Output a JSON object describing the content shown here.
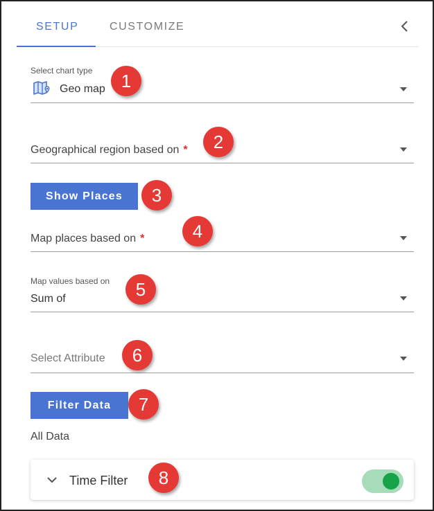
{
  "tabs": {
    "setup": "SETUP",
    "customize": "CUSTOMIZE",
    "active": "setup"
  },
  "chart_type": {
    "caption": "Select chart type",
    "value": "Geo map",
    "icon": "geo-map-icon"
  },
  "region": {
    "label": "Geographical region based on",
    "required_mark": "*"
  },
  "show_places_button": "Show Places",
  "map_places": {
    "label": "Map places based on",
    "required_mark": "*"
  },
  "map_values": {
    "caption": "Map values based on",
    "value": "Sum of"
  },
  "attribute": {
    "placeholder": "Select Attribute"
  },
  "filter_button": "Filter Data",
  "filter_summary": "All Data",
  "time_filter": {
    "title": "Time Filter",
    "enabled": true
  },
  "callouts": [
    "1",
    "2",
    "3",
    "4",
    "5",
    "6",
    "7",
    "8"
  ],
  "colors": {
    "accent": "#4a74d2",
    "callout": "#e53935",
    "toggle_on": "#16a34a",
    "required": "#d9332f"
  }
}
